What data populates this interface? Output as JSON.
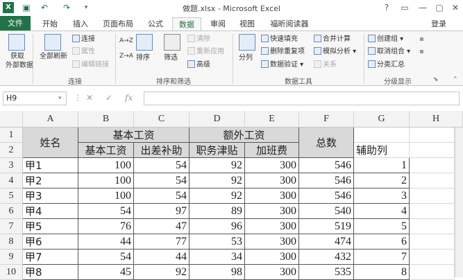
{
  "window": {
    "title": "做题.xlsx - Microsoft Excel",
    "controls": [
      "?",
      "▭",
      "—",
      "▢",
      "✕"
    ]
  },
  "quick_access": [
    "save-icon",
    "undo-icon",
    "redo-icon"
  ],
  "tabs": [
    {
      "label": "文件"
    },
    {
      "label": "开始"
    },
    {
      "label": "插入"
    },
    {
      "label": "页面布局"
    },
    {
      "label": "公式"
    },
    {
      "label": "数据"
    },
    {
      "label": "审阅"
    },
    {
      "label": "视图"
    },
    {
      "label": "福昕阅读器"
    }
  ],
  "login": "登录",
  "ribbon": {
    "get_data": "获取\n外部数据",
    "get_data_l1": "获取",
    "get_data_l2": "外部数据",
    "refresh_all_l1": "全部刷新",
    "connections": "连接",
    "properties": "属性",
    "edit_links": "编辑链接",
    "group_connections": "连接",
    "sort_az": "A→Z",
    "sort_za": "Z→A",
    "sort": "排序",
    "filter": "筛选",
    "clear": "清除",
    "reapply": "重新应用",
    "advanced": "高级",
    "group_sort": "排序和筛选",
    "text_to_columns": "分列",
    "flash_fill": "快速填充",
    "remove_dup": "删除重复项",
    "data_validation": "数据验证",
    "consolidate": "合并计算",
    "what_if": "模拟分析",
    "relationships": "关系",
    "group_tools": "数据工具",
    "group_create": "创建组",
    "ungroup": "取消组合",
    "subtotal": "分类汇总",
    "group_outline": "分级显示"
  },
  "formula_bar": {
    "name_box": "H9",
    "cancel": "✕",
    "enter": "✓",
    "fx": "fx",
    "formula": ""
  },
  "columns": [
    "A",
    "B",
    "C",
    "D",
    "E",
    "F",
    "G",
    "H"
  ],
  "rows": [
    "1",
    "2",
    "3",
    "4",
    "5",
    "6",
    "7",
    "8",
    "9",
    "10"
  ],
  "table": {
    "name_header": "姓名",
    "basic_wage": "基本工资",
    "extra_wage": "额外工资",
    "total": "总数",
    "sub_headers": [
      "基本工资",
      "出差补助",
      "职务津贴",
      "加班费"
    ],
    "helper": "辅助列",
    "rows": [
      {
        "name": "甲1",
        "b": "100",
        "c": "54",
        "d": "92",
        "e": "300",
        "f": "546",
        "g": "1"
      },
      {
        "name": "甲2",
        "b": "100",
        "c": "54",
        "d": "92",
        "e": "300",
        "f": "546",
        "g": "2"
      },
      {
        "name": "甲3",
        "b": "100",
        "c": "54",
        "d": "92",
        "e": "300",
        "f": "546",
        "g": "3"
      },
      {
        "name": "甲4",
        "b": "54",
        "c": "97",
        "d": "89",
        "e": "300",
        "f": "540",
        "g": "4"
      },
      {
        "name": "甲5",
        "b": "76",
        "c": "47",
        "d": "96",
        "e": "300",
        "f": "519",
        "g": "5"
      },
      {
        "name": "甲6",
        "b": "44",
        "c": "77",
        "d": "53",
        "e": "300",
        "f": "474",
        "g": "6"
      },
      {
        "name": "甲7",
        "b": "54",
        "c": "44",
        "d": "34",
        "e": "300",
        "f": "432",
        "g": "7"
      },
      {
        "name": "甲8",
        "b": "45",
        "c": "92",
        "d": "98",
        "e": "300",
        "f": "535",
        "g": "8"
      }
    ]
  },
  "colors": {
    "accent": "#217346",
    "header_fill": "#d9d9d9"
  }
}
